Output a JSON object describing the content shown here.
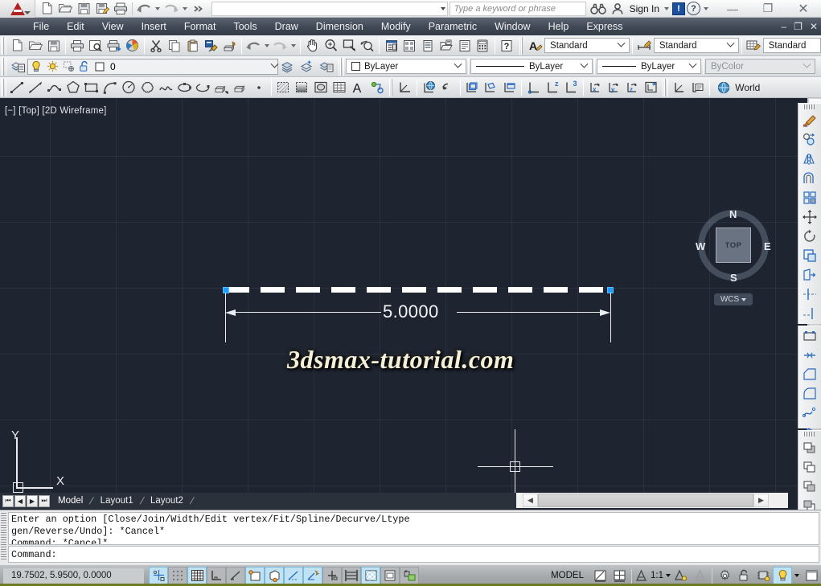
{
  "titlebar": {
    "app_logo": "autocad-a-logo",
    "quick_access": [
      {
        "name": "new",
        "icon": "new-file-icon"
      },
      {
        "name": "open",
        "icon": "open-folder-icon"
      },
      {
        "name": "save",
        "icon": "save-disk-icon"
      },
      {
        "name": "saveas",
        "icon": "save-as-icon"
      },
      {
        "name": "plot",
        "icon": "printer-icon"
      },
      {
        "name": "undo",
        "icon": "undo-arrow-icon"
      },
      {
        "name": "redo",
        "icon": "redo-arrow-icon"
      },
      {
        "name": "more",
        "icon": "more-chevrons-icon"
      }
    ],
    "search_placeholder": "Type a keyword or phrase",
    "search_value": "",
    "sign_in_label": "Sign In",
    "info_badge": "!",
    "help_badge": "?",
    "window_minimize": "—",
    "window_restore": "❐",
    "window_close": "✕"
  },
  "menubar": {
    "items": [
      {
        "label": "File"
      },
      {
        "label": "Edit"
      },
      {
        "label": "View"
      },
      {
        "label": "Insert"
      },
      {
        "label": "Format"
      },
      {
        "label": "Tools"
      },
      {
        "label": "Draw"
      },
      {
        "label": "Dimension"
      },
      {
        "label": "Modify"
      },
      {
        "label": "Parametric"
      },
      {
        "label": "Window"
      },
      {
        "label": "Help"
      },
      {
        "label": "Express"
      }
    ],
    "doc_minimize": "–",
    "doc_restore": "❐",
    "doc_close": "✕"
  },
  "toolbar_standard": {
    "buttons": [
      "new-file-icon",
      "open-folder-icon",
      "save-disk-icon",
      "plot-printer-icon",
      "plot-preview-icon",
      "publish-icon",
      "3dprint-icon",
      "cut-scissors-icon",
      "copy-icon",
      "paste-icon",
      "matchprop-brush-icon",
      "blockeditor-icon",
      "undo-arrow-icon",
      "redo-arrow-icon",
      "pan-hand-icon",
      "zoom-realtime-icon",
      "zoom-window-icon",
      "zoom-previous-icon",
      "properties-icon",
      "designcenter-icon",
      "toolpalettes-icon",
      "sheetset-icon",
      "markup-icon",
      "quickcalc-icon",
      "help-question-icon"
    ],
    "text_style_label": "Standard",
    "dim_style_label": "Standard",
    "table_style_label": "Standard"
  },
  "toolbar_layers": {
    "layer_properties_icon": "layer-properties-icon",
    "light_bulb_icon": "layer-on-bulb-icon",
    "freeze_sun_icon": "layer-freeze-sun-icon",
    "vpfreeze_icon": "layer-vpfreeze-icon",
    "lock_icon": "layer-unlock-icon",
    "layer_color_swatch": "white",
    "current_layer": "0",
    "layer_tools": [
      "layer-previous-icon",
      "layer-make-current-icon",
      "layer-state-icon"
    ],
    "color_control": "ByLayer",
    "linetype_control": "ByLayer",
    "lineweight_control": "ByLayer",
    "plotstyle_control": "ByColor"
  },
  "toolbar_draw": {
    "buttons": [
      "line-icon",
      "construction-line-icon",
      "polyline-icon",
      "polygon-icon",
      "rectangle-icon",
      "arc-icon",
      "circle-icon",
      "revision-cloud-icon",
      "spline-icon",
      "ellipse-icon",
      "ellipse-arc-icon",
      "insert-block-icon",
      "make-block-icon",
      "point-icon",
      "hatch-icon",
      "gradient-icon",
      "region-icon",
      "table-icon",
      "multiline-text-icon",
      "add-selected-icon"
    ],
    "ucs_buttons": [
      "ucs-icon",
      "world-ucs-icon",
      "previous-ucs-icon",
      "face-ucs-icon",
      "object-ucs-icon",
      "view-ucs-icon",
      "origin-ucs-icon",
      "z-axis-vector-icon",
      "3point-ucs-icon",
      "rotate-x-icon",
      "rotate-y-icon",
      "rotate-z-icon",
      "apply-ucs-icon"
    ],
    "ucs2_buttons": [
      "display-ucs-dialog-icon",
      "named-ucs-icon"
    ],
    "ucs_name": "World",
    "ucs_globe_icon": "world-globe-icon"
  },
  "canvas": {
    "viewport_label": "[−] [Top] [2D Wireframe]",
    "dimension_value": "5.0000",
    "watermark": "3dsmax-tutorial.com",
    "viewcube": {
      "face_label": "TOP",
      "north": "N",
      "east": "E",
      "south": "S",
      "west": "W",
      "wcs_label": "WCS"
    },
    "ucs_axis_x": "X",
    "ucs_axis_y": "Y",
    "background_color": "#1e2430",
    "entity_color": "#ffffff",
    "grip_color": "#1e9eff"
  },
  "tabs": {
    "nav_first": "⏮",
    "nav_prev": "◀",
    "nav_next": "▶",
    "nav_last": "⏭",
    "items": [
      {
        "label": "Model",
        "active": true
      },
      {
        "label": "Layout1",
        "active": false
      },
      {
        "label": "Layout2",
        "active": false
      }
    ]
  },
  "command_line": {
    "history": [
      "Enter an option [Close/Join/Width/Edit vertex/Fit/Spline/Decurve/Ltype",
      "gen/Reverse/Undo]: *Cancel*",
      "Command: *Cancel*"
    ],
    "prompt": "Command:",
    "input_value": ""
  },
  "status_bar": {
    "coordinates": "19.7502, 5.9500, 0.0000",
    "toggles": [
      {
        "name": "infer-constraints",
        "icon": "infer-constraints-icon",
        "state": "on"
      },
      {
        "name": "snap-mode",
        "icon": "snap-grid-icon",
        "state": "off"
      },
      {
        "name": "grid-display",
        "icon": "grid-display-icon",
        "state": "on"
      },
      {
        "name": "ortho-mode",
        "icon": "ortho-mode-icon",
        "state": "off"
      },
      {
        "name": "polar-tracking",
        "icon": "polar-tracking-icon",
        "state": "off"
      },
      {
        "name": "object-snap",
        "icon": "object-snap-icon",
        "state": "on"
      },
      {
        "name": "3d-object-snap",
        "icon": "3d-object-snap-icon",
        "state": "on"
      },
      {
        "name": "object-snap-tracking",
        "icon": "otrack-icon",
        "state": "on"
      },
      {
        "name": "dynamic-ucs",
        "icon": "dynamic-ucs-icon",
        "state": "on"
      },
      {
        "name": "dynamic-input",
        "icon": "dynamic-input-icon",
        "state": "off"
      },
      {
        "name": "lineweight",
        "icon": "lineweight-icon",
        "state": "off"
      },
      {
        "name": "transparency",
        "icon": "transparency-icon",
        "state": "on"
      },
      {
        "name": "quick-properties",
        "icon": "quick-properties-icon",
        "state": "off"
      },
      {
        "name": "selection-cycling",
        "icon": "selection-cycling-icon",
        "state": "off"
      }
    ],
    "space_label": "MODEL",
    "layout_icons": [
      "model-space-icon",
      "viewport-layout-icon"
    ],
    "annotation_scale": "1:1",
    "annotation_icons": [
      "annotation-visibility-icon",
      "auto-scale-icon"
    ],
    "right_icons": [
      "workspace-gear-icon",
      "toolbar-lock-icon",
      "hardware-accel-icon",
      "isolate-objects-icon",
      "clean-screen-icon"
    ]
  }
}
